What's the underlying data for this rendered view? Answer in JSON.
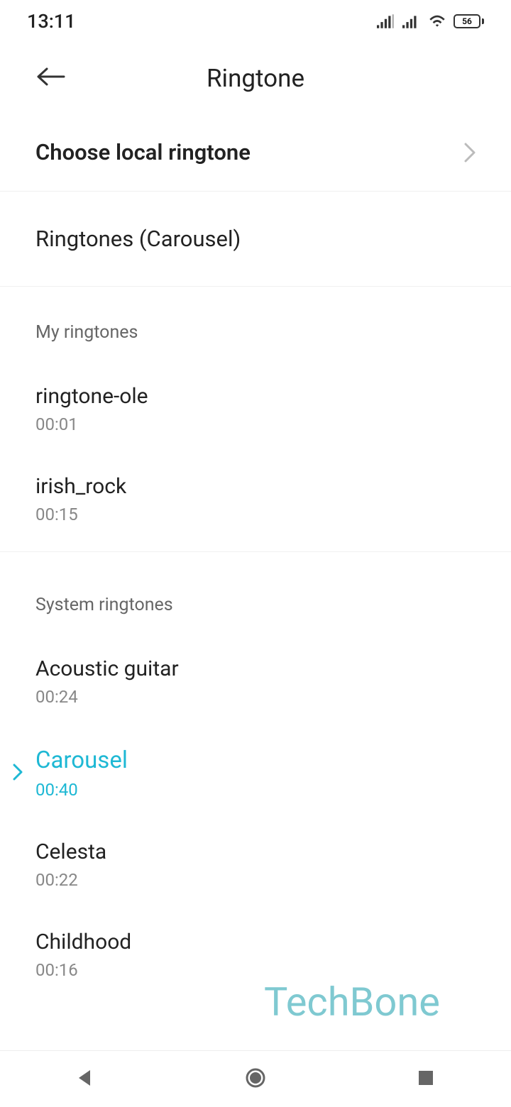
{
  "statusBar": {
    "time": "13:11",
    "battery": "56"
  },
  "header": {
    "title": "Ringtone"
  },
  "chooseLocal": {
    "label": "Choose local ringtone"
  },
  "currentSelection": {
    "label": "Ringtones (Carousel)"
  },
  "sections": {
    "myRingtones": {
      "title": "My ringtones",
      "items": [
        {
          "name": "ringtone-ole",
          "duration": "00:01"
        },
        {
          "name": "irish_rock",
          "duration": "00:15"
        }
      ]
    },
    "systemRingtones": {
      "title": "System ringtones",
      "items": [
        {
          "name": "Acoustic guitar",
          "duration": "00:24",
          "selected": false
        },
        {
          "name": "Carousel",
          "duration": "00:40",
          "selected": true
        },
        {
          "name": "Celesta",
          "duration": "00:22",
          "selected": false
        },
        {
          "name": "Childhood",
          "duration": "00:16",
          "selected": false
        }
      ]
    }
  },
  "watermark": "TechBone"
}
